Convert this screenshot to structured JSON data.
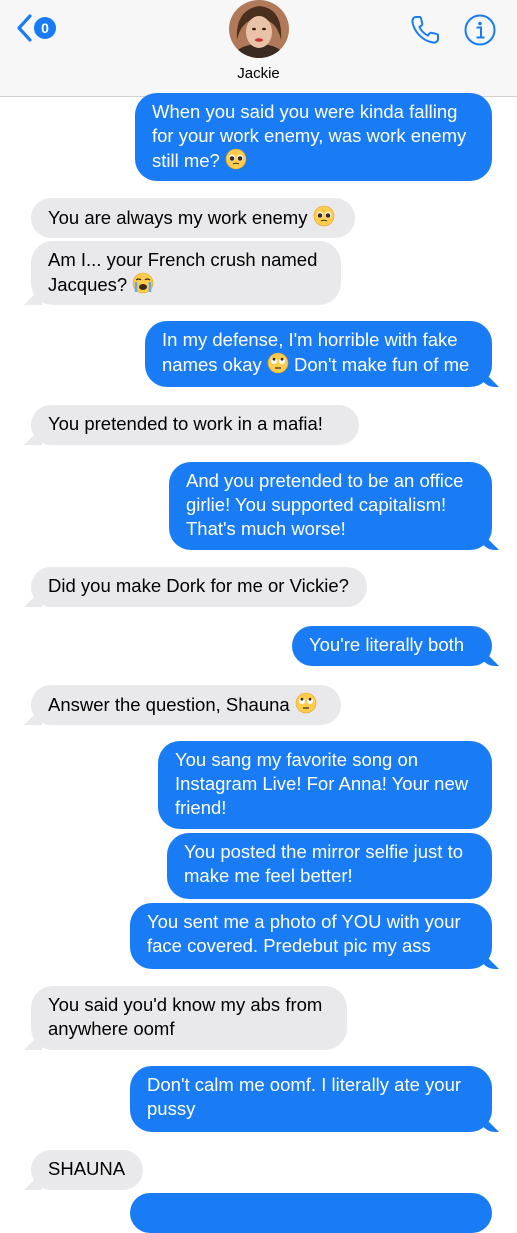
{
  "header": {
    "back_badge": "0",
    "contact_name": "Jackie"
  },
  "messages": [
    {
      "from": "me",
      "text": "When you said you were kinda falling for your work enemy, was work enemy still me?",
      "emoji": "pleading-face"
    },
    {
      "from": "them",
      "text": "You are always my work enemy",
      "emoji": "pleading-face"
    },
    {
      "from": "them",
      "text": "Am I... your French crush named Jacques?",
      "emoji": "loudly-crying-face"
    },
    {
      "from": "me",
      "text_a": "In my defense, I'm horrible with fake names okay",
      "emoji": "rolling-eyes-face",
      "text_b": "Don't make fun of me"
    },
    {
      "from": "them",
      "text": "You pretended to work in a mafia!"
    },
    {
      "from": "me",
      "text": "And you pretended to be an office girlie! You supported capitalism! That's much worse!"
    },
    {
      "from": "them",
      "text": "Did you make Dork for me or Vickie?"
    },
    {
      "from": "me",
      "text": "You're literally both"
    },
    {
      "from": "them",
      "text": "Answer the question, Shauna",
      "emoji": "rolling-eyes-face"
    },
    {
      "from": "me",
      "text": "You sang my favorite song on Instagram Live! For Anna! Your new friend!"
    },
    {
      "from": "me",
      "text": "You posted the mirror selfie just to make me feel better!"
    },
    {
      "from": "me",
      "text": "You sent me a photo of YOU with your face covered. Predebut pic my ass"
    },
    {
      "from": "them",
      "text": "You said you'd know my abs from anywhere oomf"
    },
    {
      "from": "me",
      "text": "Don't calm me oomf. I literally ate your pussy"
    },
    {
      "from": "them",
      "text": "SHAUNA"
    }
  ],
  "colors": {
    "outgoing": "#1a7cf5",
    "incoming": "#e9e9eb",
    "accent": "#1a7cf5"
  }
}
